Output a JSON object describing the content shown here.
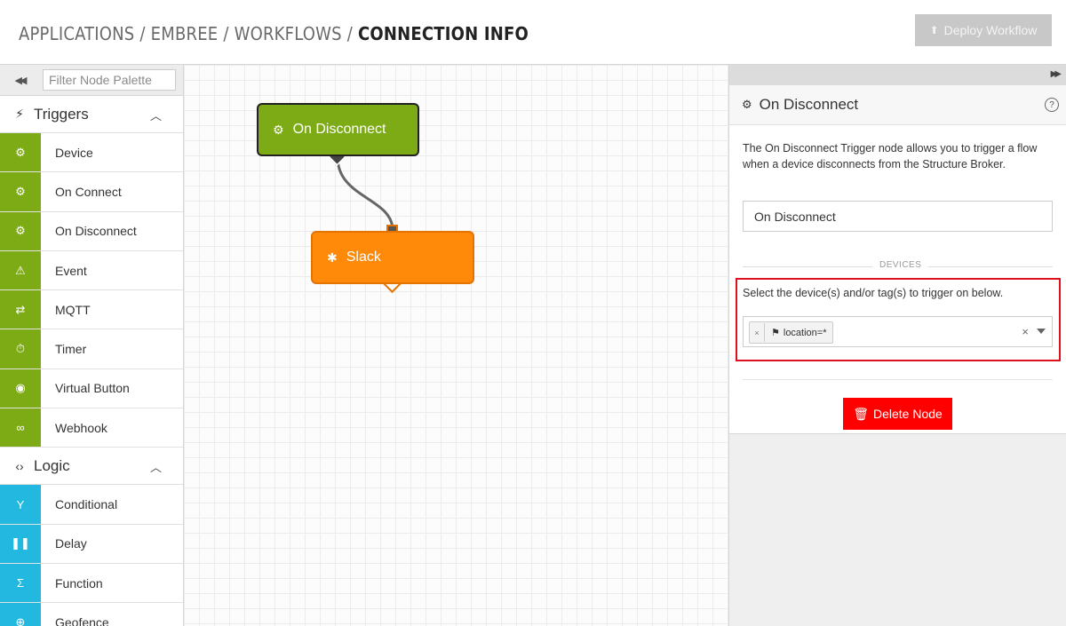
{
  "header": {
    "breadcrumb": [
      "APPLICATIONS",
      "EMBREE",
      "WORKFLOWS"
    ],
    "current": "CONNECTION INFO",
    "separator": "/",
    "deploy_label": "Deploy Workflow"
  },
  "palette": {
    "filter_placeholder": "Filter Node Palette",
    "groups": [
      {
        "label": "Triggers",
        "items": [
          {
            "label": "Device",
            "icon": "chip-icon"
          },
          {
            "label": "On Connect",
            "icon": "chip-icon"
          },
          {
            "label": "On Disconnect",
            "icon": "chip-icon"
          },
          {
            "label": "Event",
            "icon": "warning-icon"
          },
          {
            "label": "MQTT",
            "icon": "exchange-icon"
          },
          {
            "label": "Timer",
            "icon": "stopwatch-icon"
          },
          {
            "label": "Virtual Button",
            "icon": "radio-button-icon"
          },
          {
            "label": "Webhook",
            "icon": "link-icon"
          }
        ]
      },
      {
        "label": "Logic",
        "items": [
          {
            "label": "Conditional",
            "icon": "split-icon"
          },
          {
            "label": "Delay",
            "icon": "pause-icon"
          },
          {
            "label": "Function",
            "icon": "sigma-icon"
          },
          {
            "label": "Geofence",
            "icon": "target-icon"
          }
        ]
      }
    ]
  },
  "canvas": {
    "nodes": [
      {
        "label": "On Disconnect",
        "type": "trigger",
        "color": "#7dab16"
      },
      {
        "label": "Slack",
        "type": "output",
        "color": "#ff8a0a"
      }
    ]
  },
  "panel": {
    "title": "On Disconnect",
    "description": "The On Disconnect Trigger node allows you to trigger a flow when a device disconnects from the Structure Broker.",
    "name_value": "On Disconnect",
    "section_label": "DEVICES",
    "select_help": "Select the device(s) and/or tag(s) to trigger on below.",
    "tag": "location=*",
    "delete_label": "Delete Node"
  },
  "colors": {
    "trigger": "#7dab16",
    "logic": "#22b8e0",
    "delete": "#ff0000",
    "highlight": "#e0101e"
  }
}
